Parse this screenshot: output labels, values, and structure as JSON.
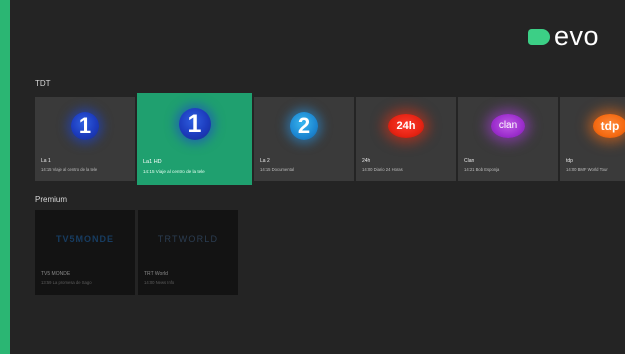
{
  "brand": {
    "name": "evo",
    "accent": "#2bb673",
    "logo_mark_color": "#3ccf86"
  },
  "sections": [
    {
      "title": "TDT",
      "channels": [
        {
          "logo_text": "1",
          "logo_style": "blue-circle",
          "name": "La 1",
          "program": "14:15 Viaje al centro de la tele"
        },
        {
          "logo_text": "1",
          "logo_style": "blue-circle",
          "name": "La1 HD",
          "program": "14:15 Viaje al centro de la tele",
          "focused": true
        },
        {
          "logo_text": "2",
          "logo_style": "cyan-circle",
          "name": "La 2",
          "program": "14:15 Documental"
        },
        {
          "logo_text": "24h",
          "logo_style": "red-oval",
          "name": "24h",
          "program": "14:00 Diario 24 Horas"
        },
        {
          "logo_text": "clan",
          "logo_style": "purple-oval",
          "name": "Clan",
          "program": "14:21 Bob Esponja"
        },
        {
          "logo_text": "tdp",
          "logo_style": "orange-oval",
          "name": "tdp",
          "program": "14:00 BMF World Tour"
        }
      ]
    },
    {
      "title": "Premium",
      "channels": [
        {
          "logo_text": "TV5MONDE",
          "name": "TV5 MONDE",
          "program": "13:59 La promesa de Sago"
        },
        {
          "logo_text": "TRTWORLD",
          "name": "TRT World",
          "program": "14:00 News Info"
        }
      ]
    }
  ]
}
